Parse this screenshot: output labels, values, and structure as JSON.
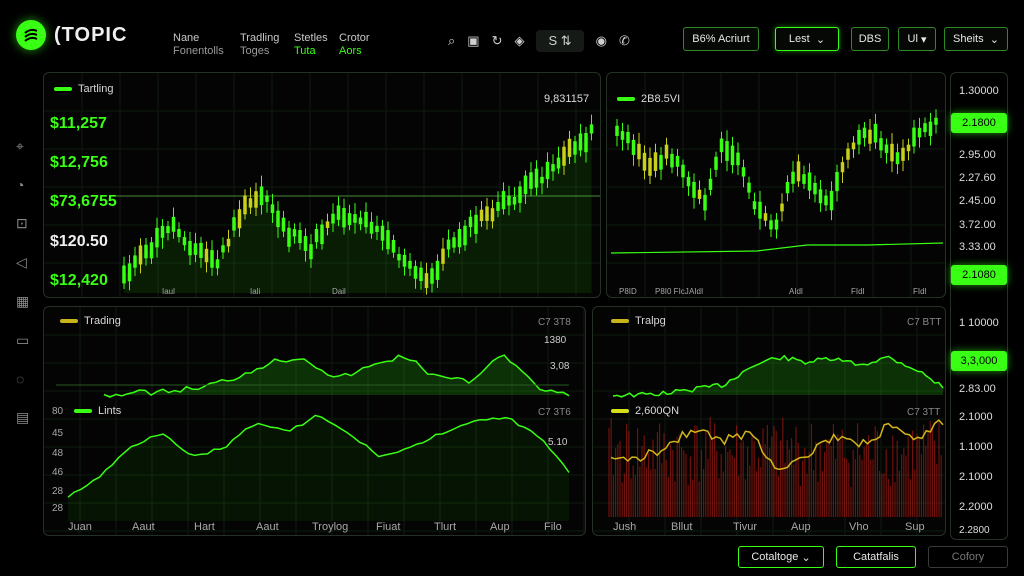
{
  "app": {
    "title": "(TOPIC"
  },
  "nav": [
    {
      "line1": "Nane",
      "line2": "Fonentolls"
    },
    {
      "line1": "Tradling",
      "line2": "Toges"
    },
    {
      "line1": "Stetles",
      "line2": "Tuta"
    },
    {
      "line1": "Crotor",
      "line2": "Aors"
    }
  ],
  "toolbar": {
    "ss_label": "S",
    "account_label": "B6% Acriurt",
    "lest_label": "Lest",
    "dbs_label": "DBS",
    "ul_label": "Ul",
    "sheets_label": "Sheits"
  },
  "main_chart": {
    "title": "Tartling",
    "value": "9,831157",
    "prices": [
      "$11,257",
      "$12,756",
      "$73,6755",
      "$120.50",
      "$12,420"
    ],
    "xticks": [
      "Iaul",
      "Iali",
      "Dail"
    ]
  },
  "right_chart": {
    "title": "2B8.5VI",
    "xticks": [
      "P8ID",
      "P8I0 FIcJ",
      "AIdI",
      "AIdl",
      "FIdI",
      "FIdl"
    ]
  },
  "trading_panel": {
    "title": "Trading",
    "code": "C7 3T8",
    "v1": "1380",
    "v2": "3,08",
    "yaxis": [
      "80",
      "45",
      "48",
      "46",
      "28",
      "28"
    ]
  },
  "lints_panel": {
    "title": "Lints",
    "code": "C7 3T6",
    "v1": "5.10",
    "xticks": [
      "Juan",
      "Aaut",
      "Hart",
      "Aaut",
      "Troylog",
      "Fiuat",
      "Tlurt",
      "Aup",
      "Filo"
    ]
  },
  "tralpg_panel": {
    "title": "Tralpg",
    "code": "C7 BTT"
  },
  "vol_panel": {
    "title": "2,600QN",
    "code": "C7 3TT",
    "xticks": [
      "Jush",
      "Bllut",
      "Tivur",
      "Aup",
      "Vho",
      "Sup"
    ]
  },
  "right_scale": [
    "1.30000",
    "2.1800",
    "2.95.00",
    "2.27.60",
    "2.45.00",
    "3.72.00",
    "3.33.00",
    "2.1080",
    "1 10000",
    "3,3,000",
    "2.83.00",
    "2.1000",
    "1.1000",
    "2.1000",
    "2.2000",
    "2.2800"
  ],
  "bottom": {
    "cat_label": "Cotaltoge",
    "cat2_label": "Catatfalis",
    "cat3_label": "Cofory"
  },
  "colors": {
    "accent": "#39ff14",
    "candle_up": "#39ff14",
    "candle_alt": "#c8d01a",
    "bg": "#000000",
    "panel_border": "#253025"
  }
}
